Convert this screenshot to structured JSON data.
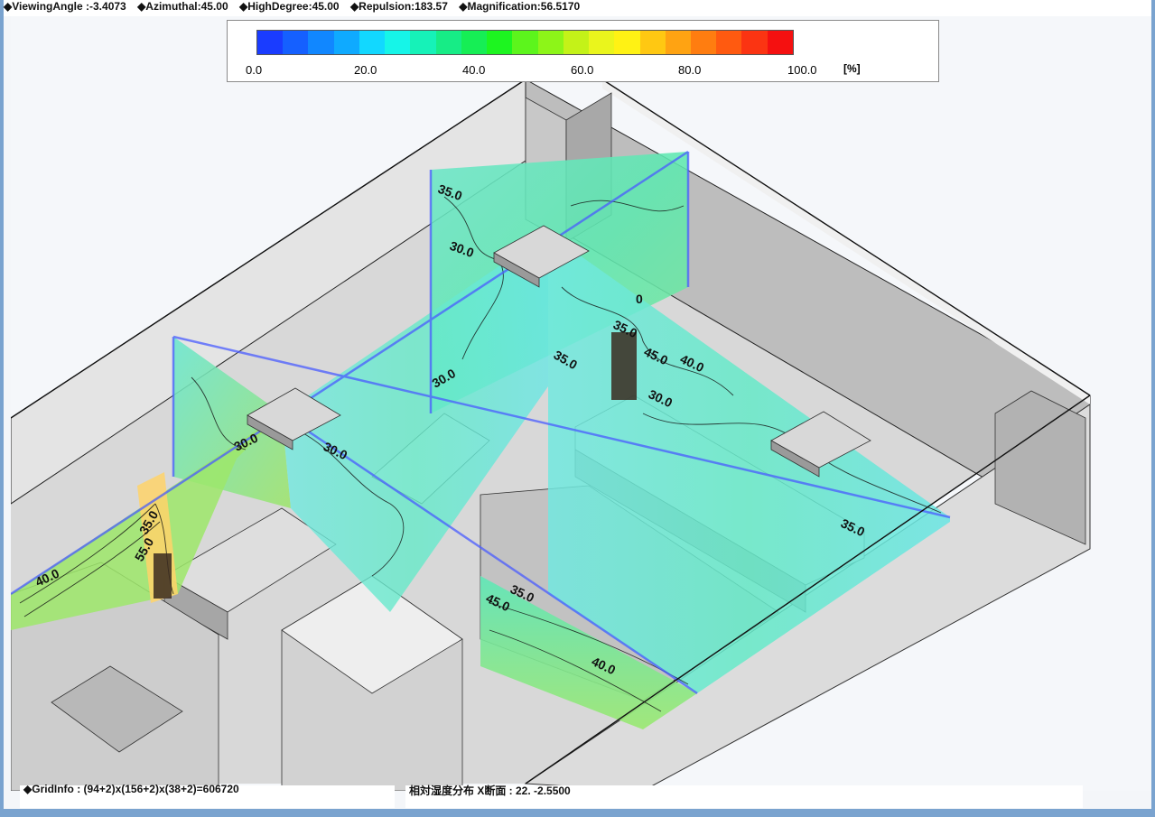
{
  "header": {
    "viewing_angle": "◆ViewingAngle :-3.4073",
    "azimuthal": "◆Azimuthal:45.00",
    "high_degree": "◆HighDegree:45.00",
    "repulsion": "◆Repulsion:183.57",
    "magnification": "◆Magnification:56.5170"
  },
  "legend": {
    "ticks": [
      "0.0",
      "20.0",
      "40.0",
      "60.0",
      "80.0",
      "100.0"
    ],
    "unit": "[%]",
    "colors": [
      "#1a3cff",
      "#1560ff",
      "#1187ff",
      "#0faaff",
      "#12d8ff",
      "#16f5e8",
      "#16f2b8",
      "#17ec86",
      "#16ee55",
      "#1df520",
      "#5cf51c",
      "#8df518",
      "#c4f218",
      "#eaf51c",
      "#fff214",
      "#ffc812",
      "#ffa312",
      "#ff7d10",
      "#ff5a10",
      "#fb3412",
      "#f51010"
    ]
  },
  "contours": {
    "labels": [
      "35.0",
      "30.0",
      "0",
      "35.0",
      "35.0",
      "45.0",
      "40.0",
      "30.0",
      "30.0",
      "30.0",
      "30.0",
      "35.0",
      "35.0",
      "45.0",
      "40.0",
      "35.0",
      "40.0",
      "55.0"
    ]
  },
  "status": {
    "grid_info": "◆GridInfo : (94+2)x(156+2)x(38+2)=606720",
    "cross_section": "相対湿度分布 X断面 : 22. -2.5500"
  }
}
